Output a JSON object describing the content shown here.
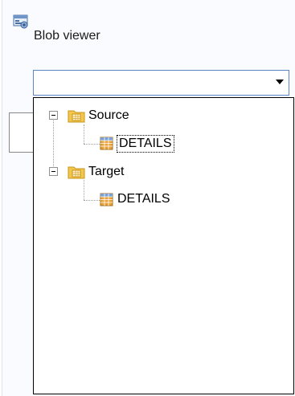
{
  "window": {
    "title": "Blob viewer"
  },
  "combo": {
    "value": ""
  },
  "tree": {
    "nodes": [
      {
        "label": "Source",
        "expanded": true,
        "children": [
          {
            "label": "DETAILS",
            "selected": true
          }
        ]
      },
      {
        "label": "Target",
        "expanded": true,
        "children": [
          {
            "label": "DETAILS",
            "selected": false
          }
        ]
      }
    ]
  },
  "icons": {
    "title": "blob-viewer-icon",
    "folder": "database-folder-icon",
    "table": "table-icon",
    "expander": "collapse-minus-icon",
    "dropdown": "chevron-down-icon"
  },
  "colors": {
    "combo_border": "#5b86c4",
    "folder_fill": "#f3c74c",
    "table_fill": "#e8a33a"
  }
}
